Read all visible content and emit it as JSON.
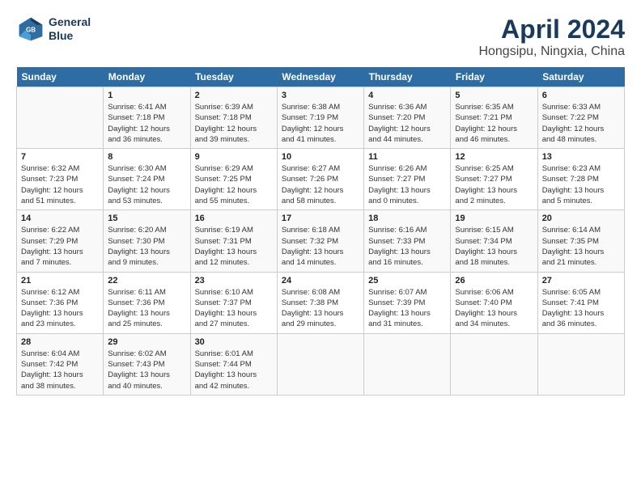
{
  "header": {
    "logo_line1": "General",
    "logo_line2": "Blue",
    "title": "April 2024",
    "subtitle": "Hongsipu, Ningxia, China"
  },
  "columns": [
    "Sunday",
    "Monday",
    "Tuesday",
    "Wednesday",
    "Thursday",
    "Friday",
    "Saturday"
  ],
  "weeks": [
    [
      {
        "day": "",
        "info": ""
      },
      {
        "day": "1",
        "info": "Sunrise: 6:41 AM\nSunset: 7:18 PM\nDaylight: 12 hours\nand 36 minutes."
      },
      {
        "day": "2",
        "info": "Sunrise: 6:39 AM\nSunset: 7:18 PM\nDaylight: 12 hours\nand 39 minutes."
      },
      {
        "day": "3",
        "info": "Sunrise: 6:38 AM\nSunset: 7:19 PM\nDaylight: 12 hours\nand 41 minutes."
      },
      {
        "day": "4",
        "info": "Sunrise: 6:36 AM\nSunset: 7:20 PM\nDaylight: 12 hours\nand 44 minutes."
      },
      {
        "day": "5",
        "info": "Sunrise: 6:35 AM\nSunset: 7:21 PM\nDaylight: 12 hours\nand 46 minutes."
      },
      {
        "day": "6",
        "info": "Sunrise: 6:33 AM\nSunset: 7:22 PM\nDaylight: 12 hours\nand 48 minutes."
      }
    ],
    [
      {
        "day": "7",
        "info": "Sunrise: 6:32 AM\nSunset: 7:23 PM\nDaylight: 12 hours\nand 51 minutes."
      },
      {
        "day": "8",
        "info": "Sunrise: 6:30 AM\nSunset: 7:24 PM\nDaylight: 12 hours\nand 53 minutes."
      },
      {
        "day": "9",
        "info": "Sunrise: 6:29 AM\nSunset: 7:25 PM\nDaylight: 12 hours\nand 55 minutes."
      },
      {
        "day": "10",
        "info": "Sunrise: 6:27 AM\nSunset: 7:26 PM\nDaylight: 12 hours\nand 58 minutes."
      },
      {
        "day": "11",
        "info": "Sunrise: 6:26 AM\nSunset: 7:27 PM\nDaylight: 13 hours\nand 0 minutes."
      },
      {
        "day": "12",
        "info": "Sunrise: 6:25 AM\nSunset: 7:27 PM\nDaylight: 13 hours\nand 2 minutes."
      },
      {
        "day": "13",
        "info": "Sunrise: 6:23 AM\nSunset: 7:28 PM\nDaylight: 13 hours\nand 5 minutes."
      }
    ],
    [
      {
        "day": "14",
        "info": "Sunrise: 6:22 AM\nSunset: 7:29 PM\nDaylight: 13 hours\nand 7 minutes."
      },
      {
        "day": "15",
        "info": "Sunrise: 6:20 AM\nSunset: 7:30 PM\nDaylight: 13 hours\nand 9 minutes."
      },
      {
        "day": "16",
        "info": "Sunrise: 6:19 AM\nSunset: 7:31 PM\nDaylight: 13 hours\nand 12 minutes."
      },
      {
        "day": "17",
        "info": "Sunrise: 6:18 AM\nSunset: 7:32 PM\nDaylight: 13 hours\nand 14 minutes."
      },
      {
        "day": "18",
        "info": "Sunrise: 6:16 AM\nSunset: 7:33 PM\nDaylight: 13 hours\nand 16 minutes."
      },
      {
        "day": "19",
        "info": "Sunrise: 6:15 AM\nSunset: 7:34 PM\nDaylight: 13 hours\nand 18 minutes."
      },
      {
        "day": "20",
        "info": "Sunrise: 6:14 AM\nSunset: 7:35 PM\nDaylight: 13 hours\nand 21 minutes."
      }
    ],
    [
      {
        "day": "21",
        "info": "Sunrise: 6:12 AM\nSunset: 7:36 PM\nDaylight: 13 hours\nand 23 minutes."
      },
      {
        "day": "22",
        "info": "Sunrise: 6:11 AM\nSunset: 7:36 PM\nDaylight: 13 hours\nand 25 minutes."
      },
      {
        "day": "23",
        "info": "Sunrise: 6:10 AM\nSunset: 7:37 PM\nDaylight: 13 hours\nand 27 minutes."
      },
      {
        "day": "24",
        "info": "Sunrise: 6:08 AM\nSunset: 7:38 PM\nDaylight: 13 hours\nand 29 minutes."
      },
      {
        "day": "25",
        "info": "Sunrise: 6:07 AM\nSunset: 7:39 PM\nDaylight: 13 hours\nand 31 minutes."
      },
      {
        "day": "26",
        "info": "Sunrise: 6:06 AM\nSunset: 7:40 PM\nDaylight: 13 hours\nand 34 minutes."
      },
      {
        "day": "27",
        "info": "Sunrise: 6:05 AM\nSunset: 7:41 PM\nDaylight: 13 hours\nand 36 minutes."
      }
    ],
    [
      {
        "day": "28",
        "info": "Sunrise: 6:04 AM\nSunset: 7:42 PM\nDaylight: 13 hours\nand 38 minutes."
      },
      {
        "day": "29",
        "info": "Sunrise: 6:02 AM\nSunset: 7:43 PM\nDaylight: 13 hours\nand 40 minutes."
      },
      {
        "day": "30",
        "info": "Sunrise: 6:01 AM\nSunset: 7:44 PM\nDaylight: 13 hours\nand 42 minutes."
      },
      {
        "day": "",
        "info": ""
      },
      {
        "day": "",
        "info": ""
      },
      {
        "day": "",
        "info": ""
      },
      {
        "day": "",
        "info": ""
      }
    ]
  ]
}
